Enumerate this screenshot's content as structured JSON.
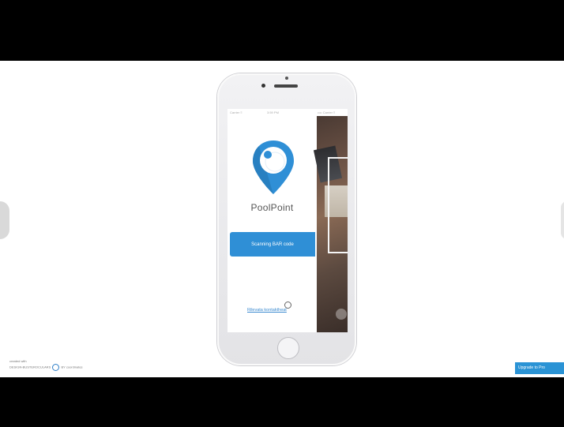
{
  "app": {
    "name": "PoolPoint",
    "scan_button_label": "Scanning BAR code",
    "link_text": "Rilevata kontaktheat"
  },
  "statusbar": {
    "left": "Carrier ≡",
    "time": "3:59 PM",
    "right": "•••• Carrier ≡"
  },
  "watermark": {
    "line1": "created with",
    "line2": "DESIGN-BUSTEROCULARS",
    "line3": "BY coordinates"
  },
  "upgrade_label": "Upgrade to Pro"
}
